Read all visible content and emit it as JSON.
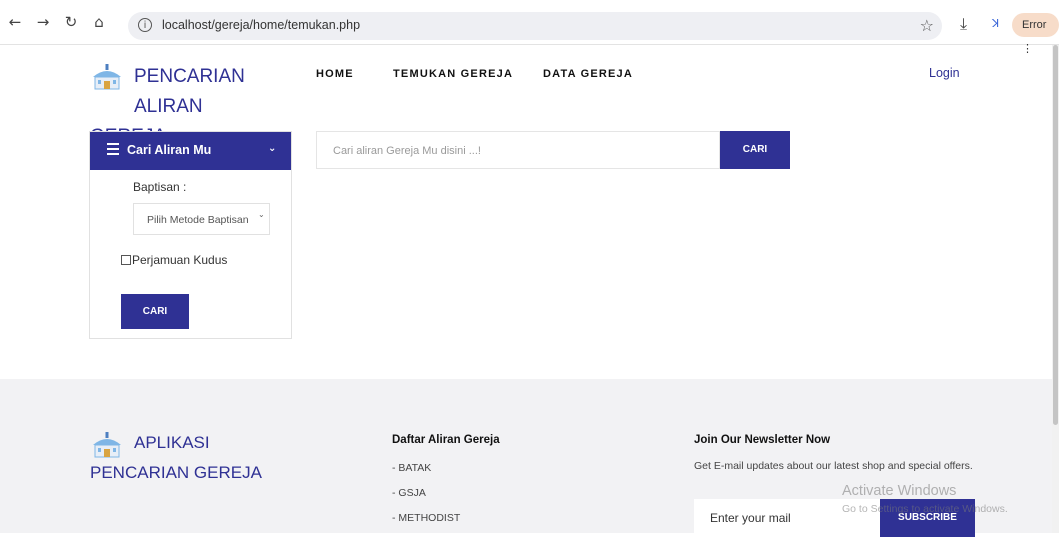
{
  "browser": {
    "back_icon": "arrow-left-icon",
    "forward_icon": "arrow-right-icon",
    "reload_icon": "reload-icon",
    "home_icon": "home-icon",
    "url": "localhost/gereja/home/temukan.php",
    "error_label": "Error"
  },
  "header": {
    "brand_line1": "PENCARIAN ALIRAN",
    "brand_line2": "GEREJA",
    "nav": [
      "HOME",
      "TEMUKAN GEREJA",
      "DATA GEREJA"
    ],
    "login": "Login"
  },
  "sidebar": {
    "title": "Cari Aliran Mu",
    "baptis_label": "Baptisan :",
    "baptis_select": "Pilih Metode Baptisan",
    "checkbox_label": "Perjamuan Kudus",
    "button": "CARI"
  },
  "search": {
    "placeholder": "Cari aliran Gereja Mu disini ...!",
    "button": "CARI"
  },
  "footer": {
    "brand_line1": "APLIKASI",
    "brand_line2": "PENCARIAN GEREJA",
    "list_title": "Daftar Aliran Gereja",
    "list_items": [
      "- BATAK",
      "- GSJA",
      "- METHODIST"
    ],
    "newsletter_title": "Join Our Newsletter Now",
    "newsletter_text": "Get E-mail updates about our latest shop and special offers.",
    "newsletter_placeholder": "Enter your mail",
    "subscribe": "SUBSCRIBE"
  },
  "watermark": {
    "line1": "Activate Windows",
    "line2": "Go to Settings to activate Windows."
  },
  "colors": {
    "primary": "#2f3194",
    "footer_bg": "#f2f2f4"
  }
}
